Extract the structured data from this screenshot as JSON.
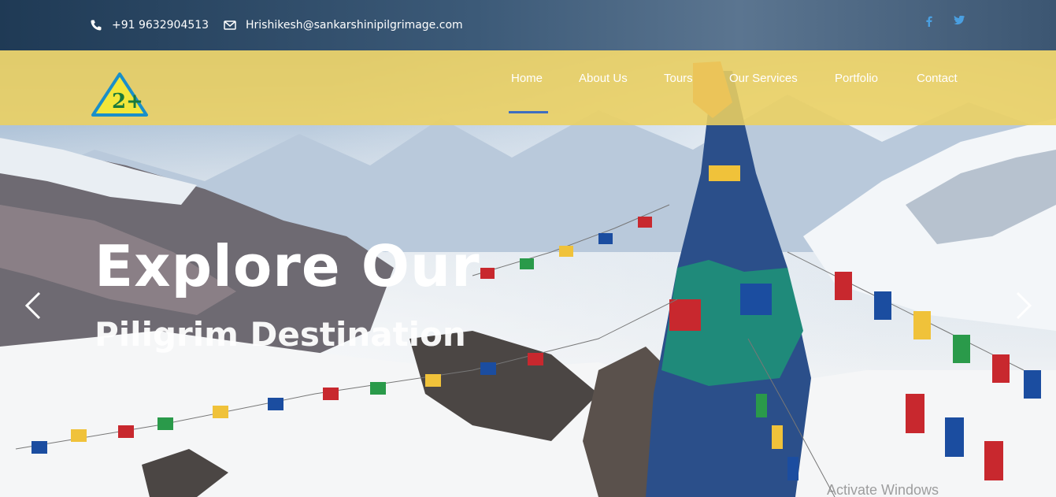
{
  "topbar": {
    "phone": "+91 9632904513",
    "email": "Hrishikesh@sankarshinipilgrimage.com",
    "social": [
      {
        "icon": "facebook-icon",
        "glyph": "f"
      },
      {
        "icon": "twitter-icon",
        "glyph": "t"
      }
    ]
  },
  "logo": {
    "text": "2+"
  },
  "nav": {
    "items": [
      "Home",
      "About Us",
      "Tours",
      "Our Services",
      "Portfolio",
      "Contact"
    ],
    "active": "Home",
    "active_color": "#3f6ec0"
  },
  "hero": {
    "title": "Explore Our",
    "subtitle": "Piligrim Destination",
    "prev_icon": "chevron-left-icon",
    "next_icon": "chevron-right-icon"
  },
  "watermark": "Activate Windows",
  "colors": {
    "nav_bar": "#ecd060",
    "topbar": "#2c4866",
    "social": "#4a9fe0"
  }
}
